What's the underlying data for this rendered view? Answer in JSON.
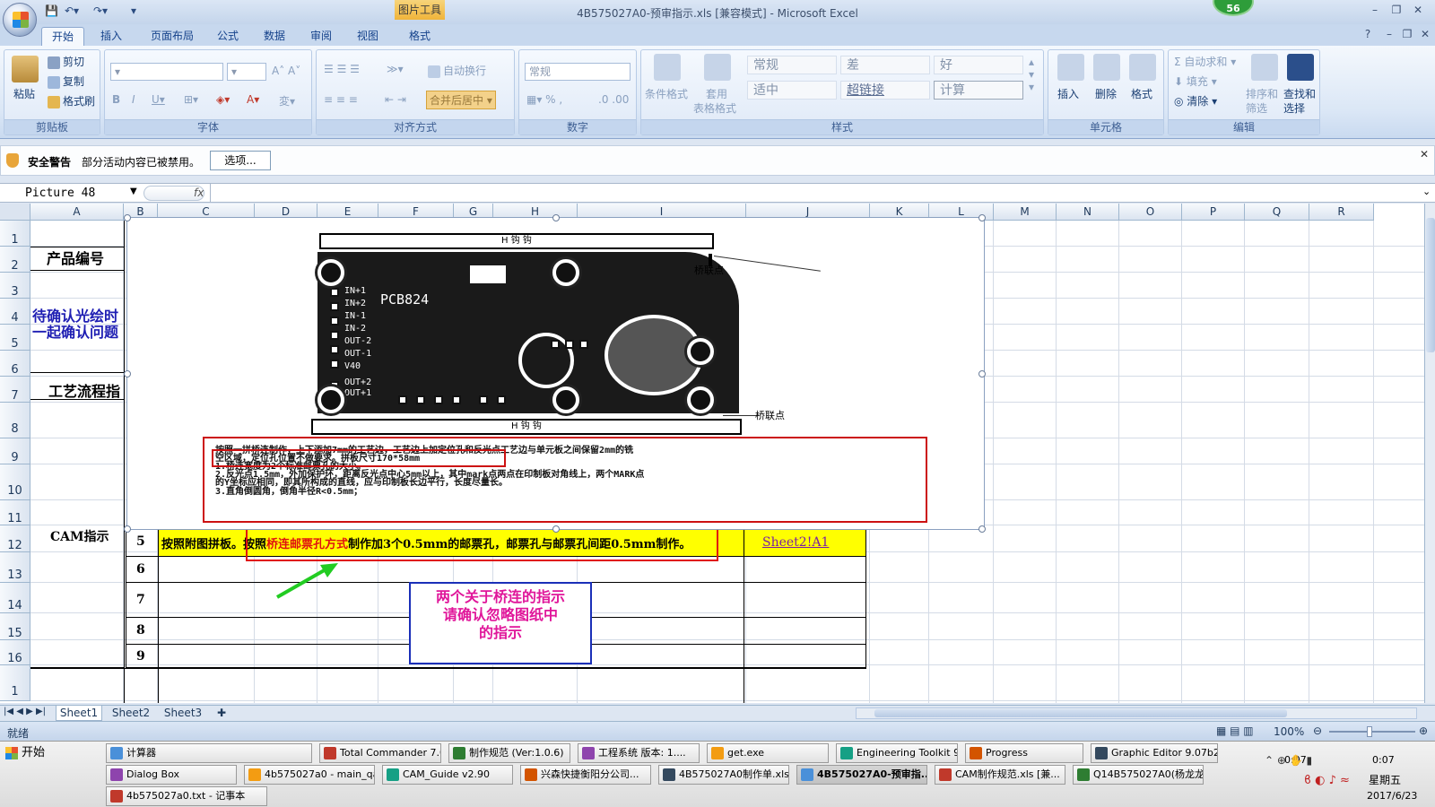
{
  "window": {
    "title": "4B575027A0-预审指示.xls  [兼容模式] - Microsoft Excel",
    "context_tab": "图片工具",
    "badge_count": "56"
  },
  "tabs": [
    "开始",
    "插入",
    "页面布局",
    "公式",
    "数据",
    "审阅",
    "视图",
    "格式"
  ],
  "ribbon": {
    "clipboard": {
      "label": "剪贴板",
      "paste": "粘贴",
      "cut": "剪切",
      "copy": "复制",
      "painter": "格式刷"
    },
    "font": {
      "label": "字体"
    },
    "align": {
      "label": "对齐方式",
      "wrap": "自动换行",
      "merge": "合并后居中"
    },
    "number": {
      "label": "数字",
      "format": "常规"
    },
    "styles": {
      "label": "样式",
      "cond": "条件格式",
      "table": "套用",
      "table2": "表格格式",
      "normal": "常规",
      "bad": "差",
      "good": "好",
      "neutral": "适中",
      "hyperlink": "超链接",
      "calc": "计算"
    },
    "cells": {
      "label": "单元格",
      "insert": "插入",
      "delete": "删除",
      "format": "格式"
    },
    "edit": {
      "label": "编辑",
      "autosum": "自动求和",
      "fill": "填充",
      "clear": "清除",
      "sort": "排序和",
      "sort2": "筛选",
      "find": "查找和",
      "find2": "选择"
    }
  },
  "security": {
    "title": "安全警告",
    "message": "部分活动内容已被禁用。",
    "button": "选项..."
  },
  "formula_bar": {
    "name_box": "Picture 48",
    "fx": "fx"
  },
  "columns": [
    "A",
    "B",
    "C",
    "D",
    "E",
    "F",
    "G",
    "H",
    "I",
    "J",
    "K",
    "L",
    "M",
    "N",
    "O",
    "P",
    "Q",
    "R"
  ],
  "rows": [
    "1",
    "2",
    "3",
    "4",
    "5",
    "6",
    "7",
    "8",
    "9",
    "10",
    "11",
    "12",
    "13",
    "14",
    "15",
    "16",
    "1"
  ],
  "cells": {
    "product_code": "产品编号",
    "confirm_line1": "待确认光绘时",
    "confirm_line2": "一起确认问题",
    "process": "工艺流程指",
    "cam": "CAM指示",
    "row_numbers": [
      "5",
      "6",
      "7",
      "8",
      "9"
    ],
    "instruction_prefix": "按照附图拼板。按照",
    "instruction_red": "桥连邮票孔方式",
    "instruction_suffix": "制作加3个0.5mm的邮票孔，邮票孔与邮票孔间距0.5mm制作。",
    "link": "Sheet2!A1",
    "note_line1": "两个关于桥连的指示",
    "note_line2": "请确认忽略图纸中",
    "note_line3": "的指示"
  },
  "picture": {
    "top_rail": "H 钩 钩",
    "bottom_rail": "H 钩 钩",
    "board_label": "PCB824",
    "bridge1": "桥联点",
    "bridge2": "桥联点",
    "pins": [
      "IN+1",
      "IN+2",
      "IN-1",
      "IN-2",
      "OUT-2",
      "OUT-1",
      "V40",
      "OUT+2",
      "OUT+1"
    ],
    "notes": [
      "按照一拼桥连制作，上下添加7mm的工艺边，工艺边上加定位孔和反光点工艺边与单元板之间保留2mm的铣",
      "空区域，定位孔位置不做要求。拼板尺寸170*58mm",
      "1.桥连宽度为2个标准邮票孔的大小。",
      "2.反光点1.5mm，外加保护环，距离反光点中心5mm以上，其中mark点两点在印制板对角线上，两个MARK点",
      "的Y坐标应相同，即其所构成的直线，应与印制板长边平行，长度尽量长。",
      "3.直角倒圆角，倒角半径R<0.5mm；"
    ]
  },
  "sheets": [
    "Sheet1",
    "Sheet2",
    "Sheet3"
  ],
  "status": {
    "ready": "就绪",
    "zoom": "100%"
  },
  "taskbar": {
    "start": "开始",
    "row1": [
      "计算器",
      "Total Commander 7.0...",
      "制作规范 (Ver:1.0.6)",
      "工程系统  版本: 1....",
      "get.exe",
      "Engineering Toolkit 9....",
      "Progress",
      "Graphic Editor 9.07b2..."
    ],
    "row2": [
      "Dialog Box",
      "4b575027a0 - main_qa",
      "CAM_Guide v2.90",
      "兴森快捷衡阳分公司...",
      "4B575027A0制作单.xls ...",
      "4B575027A0-预审指...",
      "CAM制作规范.xls [兼...",
      "Q14B575027A0(杨龙龙..."
    ],
    "row3": [
      "4b575027a0.txt - 记事本"
    ],
    "time": "0:07",
    "weekday": "星期五",
    "date": "2017/6/23"
  }
}
